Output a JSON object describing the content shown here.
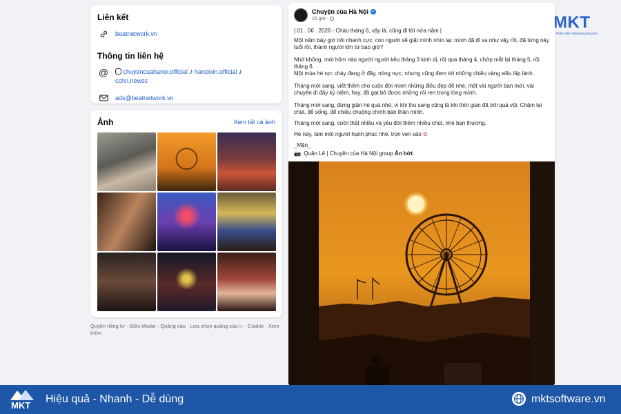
{
  "links_section": {
    "title": "Liên kết",
    "website": "beatnetwork.vn"
  },
  "contact_section": {
    "title": "Thông tin liên hệ",
    "instagram": "chuyencuahanoi.official",
    "tiktok1": "hanoixin.official",
    "tiktok2": "cchn.newss",
    "email": "ads@beatnetwork.vn"
  },
  "photos_section": {
    "title": "Ảnh",
    "see_all": "Xem tất cả ảnh"
  },
  "footer": {
    "links": "Quyền riêng tư · Điều khoản · Quảng cáo · Lựa chọn quảng cáo ▷ · Cookie · Xem thêm"
  },
  "post": {
    "author": "Chuyện của Hà Nội",
    "time": "15 giờ · ",
    "p1": "| 01 . 06 . 2026 - Chào tháng 6, vậy là, cũng đi tới nửa năm |",
    "p2": "Một năm bảy giờ trôi nhanh cực, con người sẽ giật mình nhìn lại: mình đã đi xa như vậy rồi, đã từng này tuổi rồi, thành người lớn từ bao giờ?",
    "p3": "Nhớ không, mới hôm nào người người kêu tháng 3 kinh dị, rồi qua tháng 4, chớp mắt lại tháng 5, rồi tháng 6.",
    "p4": "Một mùa hè rực cháy đang ở đây, nóng nực, nhưng cũng đem tới những chiều vàng siêu lấp lánh.",
    "p5": "Tháng mới sang, viết thêm cho cuộc đời mình những điều đẹp đẽ nhé, một vài người bạn mới, vài chuyến đi đầy kỷ niệm, hay, đã gạt bỏ được những rối ren trong lòng mình.",
    "p6": "Tháng mới sang, đừng giận hè quá nhé, vì khi thu sang cũng là khi thời gian đã trôi quá vội. Chậm lại chút, để sống, để chiều chuộng chính bản thân mình.",
    "p7": "Tháng mới sang, cười thật nhiều và yêu đời thêm nhiều chút, nhé bạn thương.",
    "p8": "Hè này, làm một người hạnh phúc nhé, trọn vẹn vào ",
    "sign": "_Mận_",
    "photo_credit": "📷: Quân Lê | Chuyện của Hà Nội group ",
    "collapse": "Ẩn bớt"
  },
  "brand": {
    "logo_text": "MKT",
    "logo_tagline": "Phần mềm Marketing đa kênh",
    "slogan": "Hiệu quả - Nhanh - Dễ dùng",
    "website": "mktsoftware.vn",
    "bar_color": "#1f57a8"
  },
  "icons": [
    "link-icon",
    "at-icon",
    "instagram-icon",
    "tiktok-icon",
    "mail-icon",
    "globe-icon",
    "verified-icon",
    "public-icon"
  ]
}
